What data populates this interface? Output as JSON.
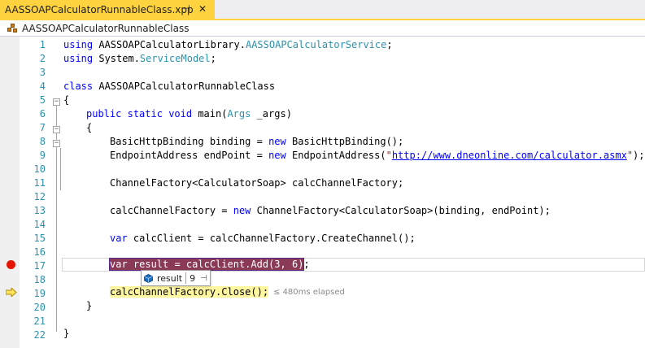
{
  "tab": {
    "title": "AASSOAPCalculatorRunnableClass.xpp",
    "pin_glyph": "⊣",
    "close_glyph": "✕"
  },
  "navbar": {
    "class_name": "AASSOAPCalculatorRunnableClass",
    "icon": "class-icon"
  },
  "editor": {
    "line_numbers": [
      "1",
      "2",
      "3",
      "4",
      "5",
      "6",
      "7",
      "8",
      "9",
      "10",
      "11",
      "12",
      "13",
      "14",
      "15",
      "16",
      "17",
      "18",
      "19",
      "20",
      "21",
      "22"
    ],
    "breakpoint_line": 17,
    "current_line": 19,
    "colors": {
      "breakpoint": "#e51400",
      "keyword": "#0000ff",
      "type": "#2b91af",
      "string": "#a31515"
    }
  },
  "code": {
    "l1": {
      "kw": "using",
      "a": " AASSOAPCalculatorLibrary.",
      "ty": "AASSOAPCalculatorService",
      "b": ";"
    },
    "l2": {
      "kw": "using",
      "a": " System.",
      "ty": "ServiceModel",
      "b": ";"
    },
    "l4": {
      "kw": "class",
      "a": " AASSOAPCalculatorRunnableClass"
    },
    "l5": "{",
    "l6": {
      "kw1": "public",
      "kw2": "static",
      "kw3": "void",
      "a": " main(",
      "ty": "Args",
      "b": " _args)"
    },
    "l7": "{",
    "l8": {
      "a": "BasicHttpBinding binding = ",
      "kw": "new",
      "b": " BasicHttpBinding();"
    },
    "l9": {
      "a": "EndpointAddress endPoint = ",
      "kw": "new",
      "b": " EndpointAddress(",
      "q1": "\"",
      "url": "http://www.dneonline.com/calculator.asmx",
      "q2": "\"",
      "c": ");"
    },
    "l11": "ChannelFactory<CalculatorSoap> calcChannelFactory;",
    "l13": {
      "a": "calcChannelFactory = ",
      "kw": "new",
      "b": " ChannelFactory<CalculatorSoap>(binding, endPoint);"
    },
    "l15": {
      "kw": "var",
      "a": " calcClient = calcChannelFactory.CreateChannel();"
    },
    "l17": {
      "hl": "var result = calcClient.Add(3, 6)",
      "b": ";"
    },
    "l19": {
      "hl": "calcChannelFactory.Close();"
    },
    "l20": "}",
    "l22": "}"
  },
  "datatip": {
    "name": "result",
    "value": "9",
    "icon": "field-cube-icon",
    "pin_glyph": "⊣"
  },
  "elapsed": "≤ 480ms elapsed"
}
